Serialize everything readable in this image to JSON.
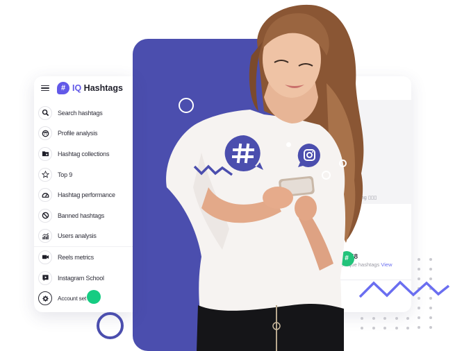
{
  "brand": {
    "logo_glyph": "#",
    "prefix": "IQ",
    "name": " Hashtags",
    "accent_color": "#6259e8",
    "panel_color": "#4b4eae",
    "green_color": "#16cc82",
    "zigzag_color": "#6a6ef0"
  },
  "sidebar": {
    "menu_icon": "hamburger-icon",
    "items": [
      {
        "label": "Search hashtags",
        "icon": "search-icon"
      },
      {
        "label": "Profile analysis",
        "icon": "face-icon"
      },
      {
        "label": "Hashtag collections",
        "icon": "folder-icon"
      },
      {
        "label": "Top 9",
        "icon": "star-icon"
      },
      {
        "label": "Hashtag performance",
        "icon": "gauge-icon"
      },
      {
        "label": "Banned hashtags",
        "icon": "ban-icon"
      },
      {
        "label": "Users analysis",
        "icon": "chart-icon"
      },
      {
        "label": "Reels metrics",
        "icon": "video-icon"
      },
      {
        "label": "Instagram School",
        "icon": "play-box-icon"
      },
      {
        "label": "Account set",
        "icon": "gear-icon"
      }
    ]
  },
  "right_card": {
    "caption": "tagi # Mentoring ▯▯▯",
    "stat_badge_glyph": "#",
    "stat_number": "4 558",
    "stat_label": "Unique hashtags ",
    "stat_link": "View"
  },
  "floating": {
    "hashtag_bubble_icon": "hashtag-icon",
    "instagram_bubble_icon": "instagram-icon"
  }
}
